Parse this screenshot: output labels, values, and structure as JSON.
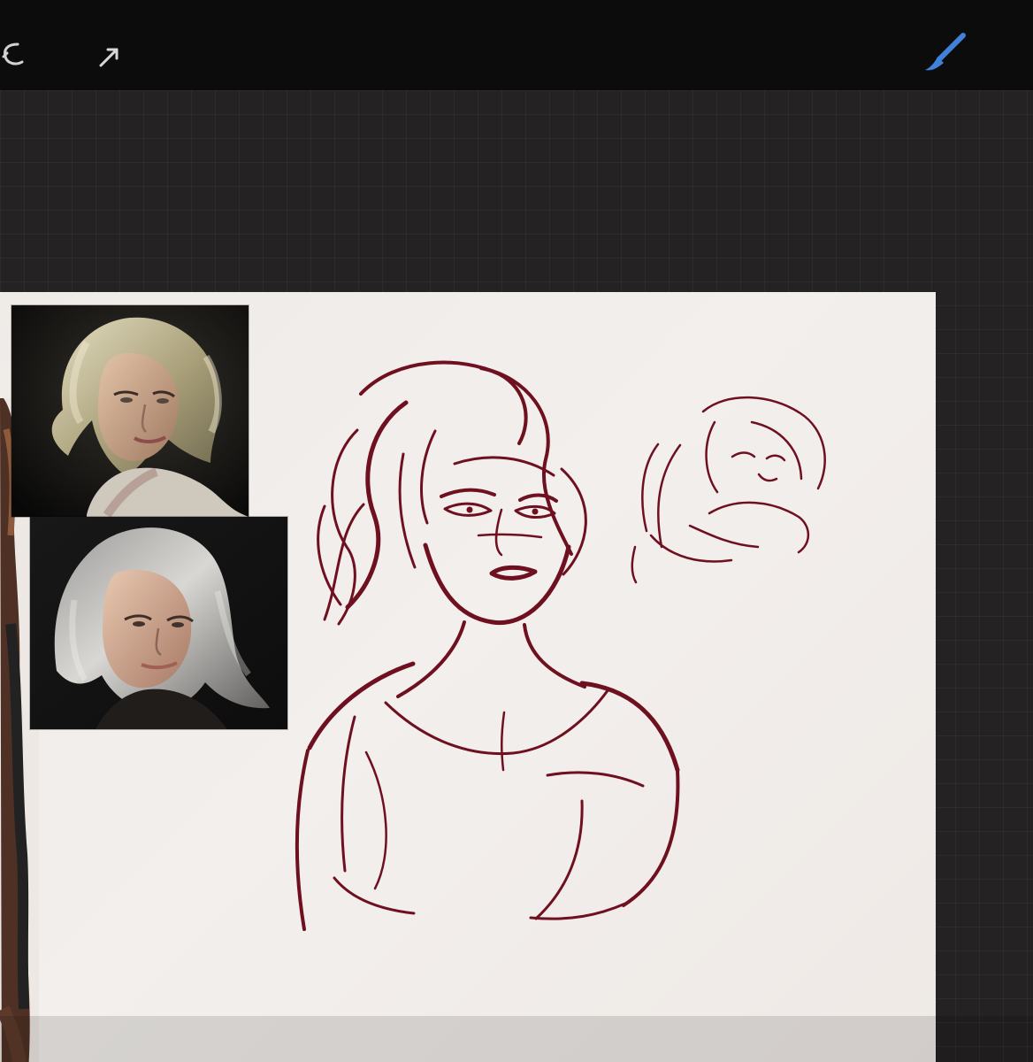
{
  "app": {
    "toolbar": {
      "undo_icon": "undo-icon",
      "selection_icon": "selection-arrow-icon",
      "brush_icon": "brush-icon",
      "accent_color": "#3f82d8"
    },
    "canvas": {
      "reference_images": [
        "top-reference-portrait",
        "bottom-reference-portrait",
        "side-reference-figure"
      ],
      "sketch_color": "#6f1020"
    }
  }
}
